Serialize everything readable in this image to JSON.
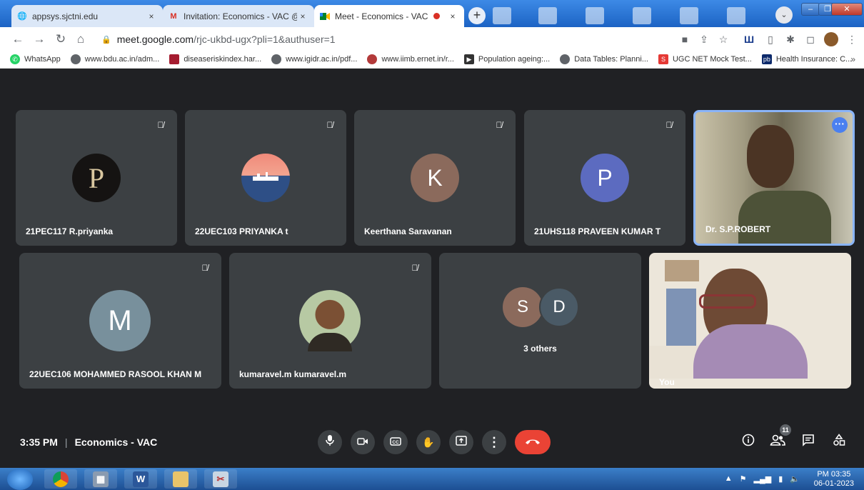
{
  "tabs": [
    {
      "title": "appsys.sjctni.edu",
      "close": "×"
    },
    {
      "title": "Invitation: Economics - VAC @ D",
      "close": "×"
    },
    {
      "title": "Meet - Economics - VAC",
      "close": "×"
    }
  ],
  "new_tab": "+",
  "address_bar": {
    "url_host": "meet.google.com",
    "url_path": "/rjc-ukbd-ugx?pli=1&authuser=1"
  },
  "bookmarks": [
    {
      "label": "WhatsApp",
      "icon": "whatsapp-icon",
      "color": "#25d366"
    },
    {
      "label": "www.bdu.ac.in/adm...",
      "icon": "globe-icon",
      "color": "#5f6368"
    },
    {
      "label": "diseaseriskindex.har...",
      "icon": "crest-icon",
      "color": "#a51c30"
    },
    {
      "label": "www.igidr.ac.in/pdf...",
      "icon": "globe-icon",
      "color": "#5f6368"
    },
    {
      "label": "www.iimb.ernet.in/r...",
      "icon": "arch-icon",
      "color": "#b33a3a"
    },
    {
      "label": "Population ageing:...",
      "icon": "play-icon",
      "color": "#333333"
    },
    {
      "label": "Data Tables: Planni...",
      "icon": "globe-icon",
      "color": "#5f6368"
    },
    {
      "label": "UGC NET Mock Test...",
      "icon": "s-icon",
      "color": "#e53935"
    },
    {
      "label": "Health Insurance: C...",
      "icon": "pb-icon",
      "color": "#0d2a6b"
    }
  ],
  "bookmarks_more": "»",
  "participants": [
    {
      "name": "21PEC117 R.priyanka",
      "avatar": "P",
      "avatar_color": "#151312"
    },
    {
      "name": "22UEC103 PRIYANKA t",
      "avatar": "",
      "avatar_color": "#2e4f86"
    },
    {
      "name": "Keerthana Saravanan",
      "avatar": "K",
      "avatar_color": "#8b6a5c"
    },
    {
      "name": "21UHS118 PRAVEEN KUMAR T",
      "avatar": "P",
      "avatar_color": "#5c6bc0"
    },
    {
      "name": "Dr. S.P.ROBERT",
      "avatar": "",
      "avatar_color": "#6f6a55"
    },
    {
      "name": "22UEC106 MOHAMMED RASOOL KHAN M",
      "avatar": "M",
      "avatar_color": "#78909c"
    },
    {
      "name": "kumaravel.m kumaravel.m",
      "avatar": "",
      "avatar_color": "#5b7a4e"
    },
    {
      "name": "",
      "avatar": "",
      "avatar_color": "#3c4043"
    },
    {
      "name": "You",
      "avatar": "",
      "avatar_color": "#a58bb5"
    }
  ],
  "others_group": {
    "label": "3 others",
    "avatars": [
      {
        "letter": "S",
        "color": "#8b6a5c"
      },
      {
        "letter": "D",
        "color": "#4a5a66"
      }
    ]
  },
  "meeting": {
    "time": "3:35 PM",
    "separator": "|",
    "title": "Economics - VAC"
  },
  "people_count": "11",
  "taskbar": {
    "clock_time": "PM 03:35",
    "clock_date": "06-01-2023"
  }
}
